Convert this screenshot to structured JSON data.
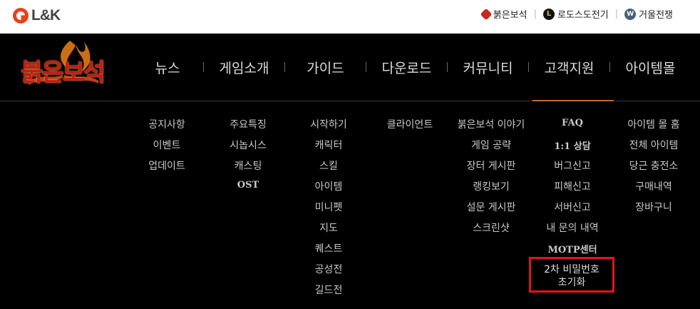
{
  "brand": {
    "name": "L&K"
  },
  "util_links": [
    {
      "label": "붉은보석",
      "icon": "ruby-icon"
    },
    {
      "label": "로도스도전기",
      "icon": "lodoss-icon",
      "badge": "L"
    },
    {
      "label": "거울전쟁",
      "icon": "winter-icon",
      "badge": "W"
    }
  ],
  "logo": {
    "text": "붉은보석"
  },
  "nav": [
    {
      "label": "뉴스"
    },
    {
      "label": "게임소개"
    },
    {
      "label": "가이드"
    },
    {
      "label": "다운로드"
    },
    {
      "label": "커뮤니티"
    },
    {
      "label": "고객지원"
    },
    {
      "label": "아이템몰"
    }
  ],
  "menus": {
    "news": [
      "공지사항",
      "이벤트",
      "업데이트"
    ],
    "intro": [
      "주요특징",
      "시놉시스",
      "캐스팅",
      "OST"
    ],
    "guide": [
      "시작하기",
      "캐릭터",
      "스킬",
      "아이템",
      "미니펫",
      "지도",
      "퀘스트",
      "공성전",
      "길드전"
    ],
    "download": [
      "클라이언트"
    ],
    "community": [
      "붉은보석 이야기",
      "게임 공략",
      "장터 게시판",
      "랭킹보기",
      "설문 게시판",
      "스크린샷"
    ],
    "support": [
      "FAQ",
      "1:1 상담",
      "버그신고",
      "피해신고",
      "서버신고",
      "내 문의 내역",
      "MOTP센터"
    ],
    "support_highlight": {
      "line1": "2차 비밀번호",
      "line2": "초기화"
    },
    "itemmall": [
      "아이템 몰 홈",
      "전체 아이템",
      "당근 충전소",
      "구매내역",
      "장바구니"
    ]
  },
  "colors": {
    "accent_line": "#c36a2c",
    "highlight_border": "#e0141c",
    "logo_red": "#c21c16"
  }
}
